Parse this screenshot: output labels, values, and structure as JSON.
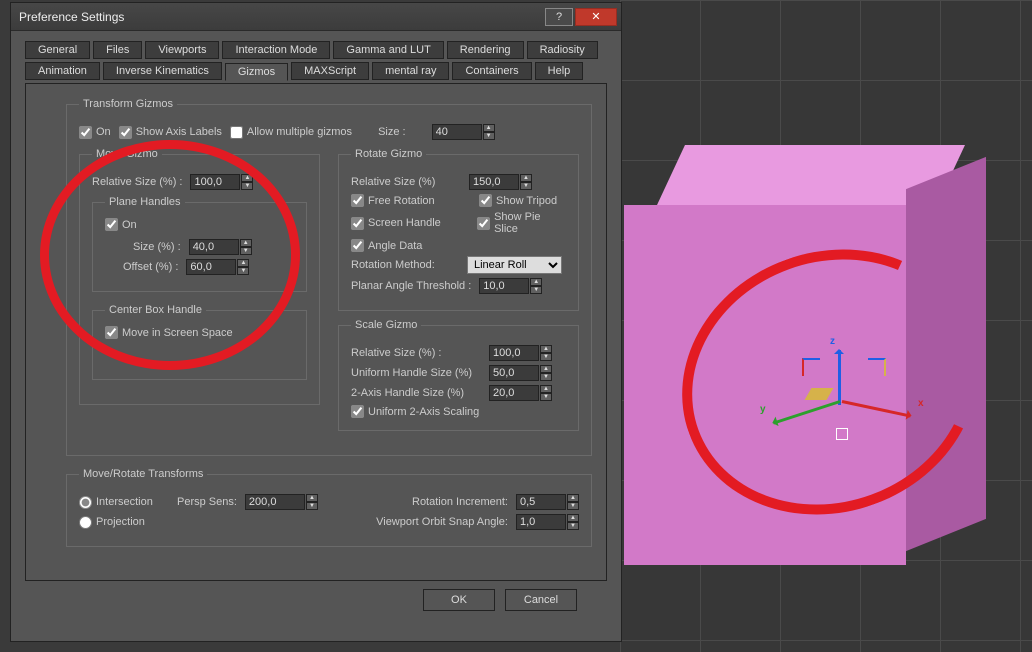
{
  "window": {
    "title": "Preference Settings"
  },
  "tabs_row1": [
    "General",
    "Files",
    "Viewports",
    "Interaction Mode",
    "Gamma and LUT",
    "Rendering",
    "Radiosity"
  ],
  "tabs_row2": [
    "Animation",
    "Inverse Kinematics",
    "Gizmos",
    "MAXScript",
    "mental ray",
    "Containers",
    "Help"
  ],
  "active_tab": "Gizmos",
  "transform_gizmos": {
    "legend": "Transform Gizmos",
    "on": {
      "label": "On",
      "checked": true
    },
    "show_axis": {
      "label": "Show Axis Labels",
      "checked": true
    },
    "allow_multiple": {
      "label": "Allow multiple gizmos",
      "checked": false
    },
    "size_label": "Size :",
    "size_value": "40",
    "move_gizmo": {
      "legend": "Move Gizmo",
      "rel_label": "Relative Size (%) :",
      "rel_value": "100,0",
      "plane_handles": {
        "legend": "Plane Handles",
        "on": {
          "label": "On",
          "checked": true
        },
        "size_label": "Size (%) :",
        "size_value": "40,0",
        "offset_label": "Offset (%) :",
        "offset_value": "60,0"
      },
      "center_box": {
        "legend": "Center Box Handle",
        "move_screen": {
          "label": "Move in Screen Space",
          "checked": true
        }
      }
    },
    "rotate_gizmo": {
      "legend": "Rotate Gizmo",
      "rel_label": "Relative Size (%)",
      "rel_value": "150,0",
      "free_rotation": {
        "label": "Free Rotation",
        "checked": true
      },
      "show_tripod": {
        "label": "Show Tripod",
        "checked": true
      },
      "screen_handle": {
        "label": "Screen Handle",
        "checked": true
      },
      "show_pie": {
        "label": "Show Pie Slice",
        "checked": true
      },
      "angle_data": {
        "label": "Angle Data",
        "checked": true
      },
      "rotation_method_label": "Rotation Method:",
      "rotation_method_value": "Linear Roll",
      "planar_label": "Planar Angle Threshold :",
      "planar_value": "10,0"
    },
    "scale_gizmo": {
      "legend": "Scale Gizmo",
      "rel_label": "Relative Size (%) :",
      "rel_value": "100,0",
      "unih_label": "Uniform Handle Size (%)",
      "unih_value": "50,0",
      "two_axis_label": "2-Axis Handle Size (%)",
      "two_axis_value": "20,0",
      "uniform_2axis": {
        "label": "Uniform 2-Axis Scaling",
        "checked": true
      }
    }
  },
  "move_rotate": {
    "legend": "Move/Rotate Transforms",
    "intersection": {
      "label": "Intersection",
      "checked": true
    },
    "projection": {
      "label": "Projection",
      "checked": false
    },
    "persp_sens_label": "Persp Sens:",
    "persp_sens_value": "200,0",
    "rot_inc_label": "Rotation Increment:",
    "rot_inc_value": "0,5",
    "orbit_label": "Viewport Orbit Snap Angle:",
    "orbit_value": "1,0"
  },
  "buttons": {
    "ok": "OK",
    "cancel": "Cancel"
  },
  "gizmo_axis": {
    "x": "x",
    "y": "y",
    "z": "z"
  }
}
